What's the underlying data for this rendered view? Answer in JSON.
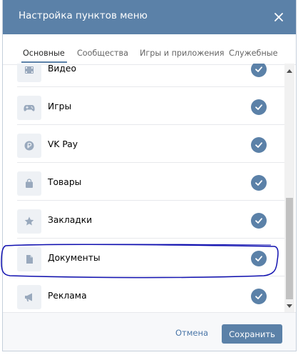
{
  "dialog": {
    "title": "Настройка пунктов меню"
  },
  "tabs": [
    {
      "label": "Основные",
      "active": true
    },
    {
      "label": "Сообщества",
      "active": false
    },
    {
      "label": "Игры и приложения",
      "active": false
    },
    {
      "label": "Служебные",
      "active": false
    }
  ],
  "items": [
    {
      "label": "Видео",
      "icon": "video-icon",
      "checked": true
    },
    {
      "label": "Игры",
      "icon": "gamepad-icon",
      "checked": true
    },
    {
      "label": "VK Pay",
      "icon": "ruble-coin-icon",
      "checked": true
    },
    {
      "label": "Товары",
      "icon": "shopping-bag-icon",
      "checked": true
    },
    {
      "label": "Закладки",
      "icon": "star-icon",
      "checked": true
    },
    {
      "label": "Документы",
      "icon": "document-icon",
      "checked": true
    },
    {
      "label": "Реклама",
      "icon": "megaphone-icon",
      "checked": true
    }
  ],
  "footer": {
    "cancel_label": "Отмена",
    "save_label": "Сохранить"
  },
  "colors": {
    "header": "#5b81a8",
    "accent": "#5b81a8",
    "icon_bg": "#eef1f5",
    "icon_fg": "#99a9bd",
    "annotation": "#1010b0"
  }
}
